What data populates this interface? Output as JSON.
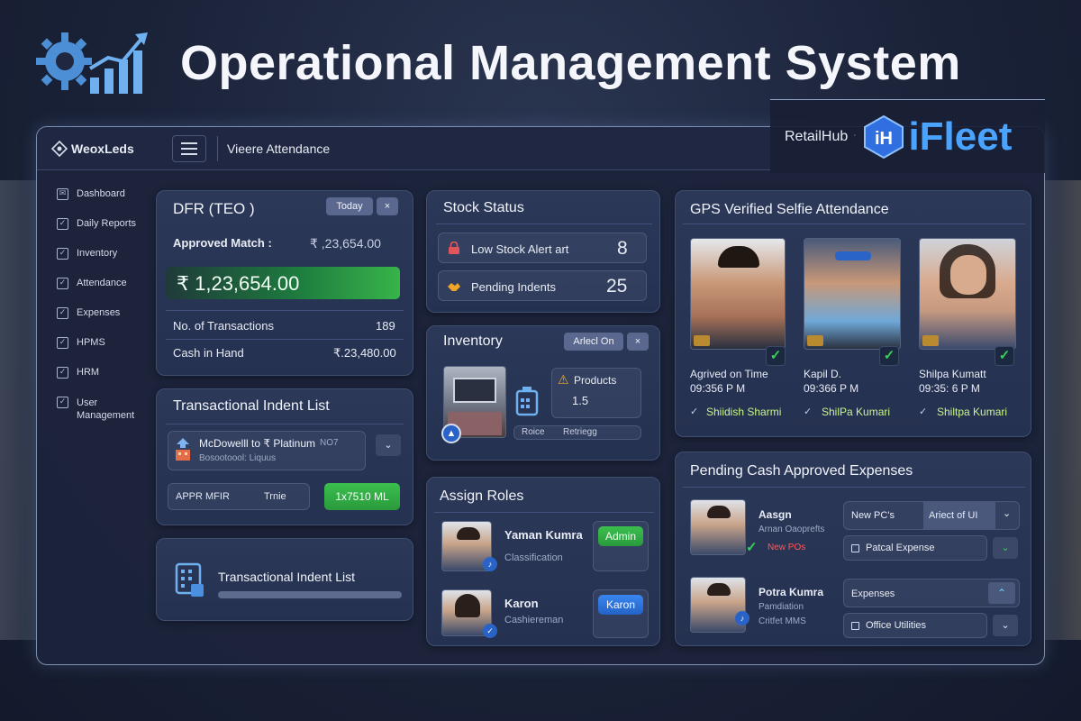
{
  "hero": {
    "title": "Operational Management System"
  },
  "brand": {
    "retail": "RetailHub",
    "sep": "ॱ",
    "name": "iFleet",
    "logo_text": "iH"
  },
  "topbar": {
    "logo_text": "WeoxLeds",
    "title": "Vieere Attendance"
  },
  "sidebar": {
    "items": [
      {
        "label": "Dashboard",
        "icon": "mail-icon"
      },
      {
        "label": "Daily Reports",
        "icon": "check-icon"
      },
      {
        "label": "Inventory",
        "icon": "check-icon"
      },
      {
        "label": "Attendance",
        "icon": "check-icon"
      },
      {
        "label": "Expenses",
        "icon": "check-icon"
      },
      {
        "label": "HPMS",
        "icon": "check-icon"
      },
      {
        "label": "HRM",
        "icon": "check-icon"
      },
      {
        "label": "User Management",
        "icon": "check-icon"
      }
    ]
  },
  "dfr": {
    "title": "DFR (TEO )",
    "today_label": "Today",
    "close_label": "×",
    "approved_label": "Approved Match :",
    "approved_value": "₹ ,23,654.00",
    "big_amount": "₹ 1,23,654.00",
    "transactions_label": "No. of Transactions",
    "transactions_value": "189",
    "cash_label": "Cash in Hand",
    "cash_value": "₹.23,480.00"
  },
  "indent": {
    "title": "Transactional Indent List",
    "item_title": "McDowelll to ₹ Platinum",
    "item_suffix": "NO7",
    "item_sub": "Bosootoool: Liquus",
    "chevron": "⌄",
    "appr_label": "APPR MFIR",
    "time_label": "Trnie",
    "action_label": "1x7510 ML"
  },
  "indent2": {
    "title": "Transactional Indent List"
  },
  "stock": {
    "title": "Stock Status",
    "low_label": "Low Stock Alert art",
    "low_value": "8",
    "pending_label": "Pending Indents",
    "pending_value": "25"
  },
  "inventory": {
    "title": "Inventory",
    "chip_label": "Arlecl On",
    "close_label": "×",
    "products_label": "Products",
    "products_value": "1.5",
    "footer_left": "Roice",
    "footer_right": "Retriegg"
  },
  "roles": {
    "title": "Assign Roles",
    "people": [
      {
        "name": "Yaman Kumra",
        "role": "Classification",
        "badge": "Admin"
      },
      {
        "name": "Karon",
        "role": "Cashiereman",
        "badge": "Karon"
      }
    ]
  },
  "selfie": {
    "title": "GPS Verified Selfie Attendance",
    "people": [
      {
        "line1": "Agrived on Time",
        "line2": "09:356 P M",
        "verified": "Shiidish Sharmi"
      },
      {
        "line1": "Kapil D.",
        "line2": "09:366 P M",
        "verified": "ShilPa Kumari"
      },
      {
        "line1": "Shilpa Kumatt",
        "line2": "09:35: 6 P M",
        "verified": "Shiltpa Kumari"
      }
    ]
  },
  "expenses": {
    "title": "Pending Cash Approved Expenses",
    "rows": [
      {
        "name": "Aasgn",
        "sub1": "Arnan Oaoprefts",
        "sub2": "New POs",
        "dropdown_left": "New PC's",
        "dropdown_right": "Ariect of UI",
        "checkbox_label": "Patcal Expense"
      },
      {
        "name": "Potra Kumra",
        "sub1": "Pamdiation",
        "sub2": "Critfet MMS",
        "dropdown_left": "Expenses",
        "dropdown_right": "",
        "checkbox_label": "Office Utilities"
      }
    ]
  },
  "colors": {
    "accent_blue": "#4aa3ff",
    "success_green": "#37b44a",
    "alert_red": "#e2545a",
    "warning_orange": "#f0a428"
  }
}
